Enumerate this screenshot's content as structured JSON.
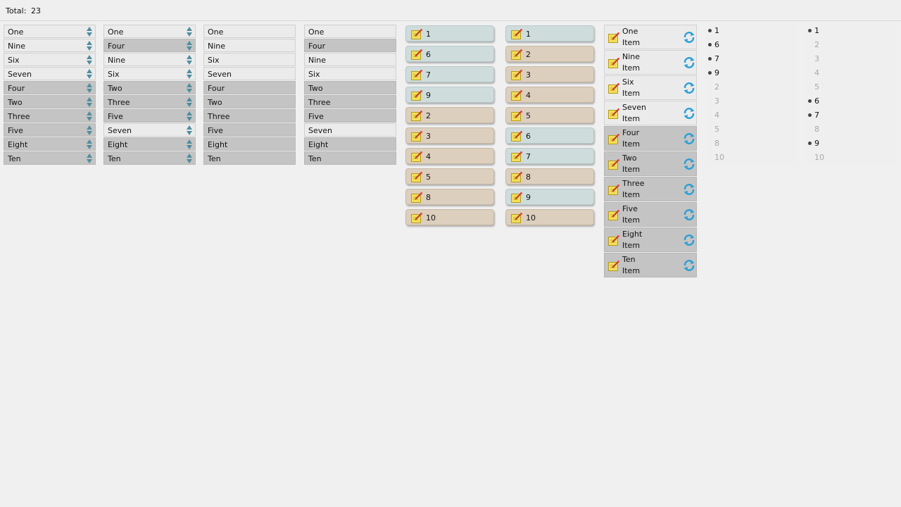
{
  "header": {
    "total_label": "Total:",
    "total_value": "23"
  },
  "spin_list_1": {
    "items": [
      {
        "label": "One",
        "selected": false
      },
      {
        "label": "Nine",
        "selected": false
      },
      {
        "label": "Six",
        "selected": false
      },
      {
        "label": "Seven",
        "selected": false
      },
      {
        "label": "Four",
        "selected": true
      },
      {
        "label": "Two",
        "selected": true
      },
      {
        "label": "Three",
        "selected": true
      },
      {
        "label": "Five",
        "selected": true
      },
      {
        "label": "Eight",
        "selected": true
      },
      {
        "label": "Ten",
        "selected": true
      }
    ]
  },
  "spin_list_2": {
    "items": [
      {
        "label": "One",
        "selected": false
      },
      {
        "label": "Four",
        "selected": true
      },
      {
        "label": "Nine",
        "selected": false
      },
      {
        "label": "Six",
        "selected": false
      },
      {
        "label": "Two",
        "selected": true
      },
      {
        "label": "Three",
        "selected": true
      },
      {
        "label": "Five",
        "selected": true
      },
      {
        "label": "Seven",
        "selected": false
      },
      {
        "label": "Eight",
        "selected": true
      },
      {
        "label": "Ten",
        "selected": true
      }
    ]
  },
  "plain_list_1": {
    "items": [
      {
        "label": "One",
        "selected": false
      },
      {
        "label": "Nine",
        "selected": false
      },
      {
        "label": "Six",
        "selected": false
      },
      {
        "label": "Seven",
        "selected": false
      },
      {
        "label": "Four",
        "selected": true
      },
      {
        "label": "Two",
        "selected": true
      },
      {
        "label": "Three",
        "selected": true
      },
      {
        "label": "Five",
        "selected": true
      },
      {
        "label": "Eight",
        "selected": true
      },
      {
        "label": "Ten",
        "selected": true
      }
    ]
  },
  "plain_list_2": {
    "items": [
      {
        "label": "One",
        "selected": false
      },
      {
        "label": "Four",
        "selected": true
      },
      {
        "label": "Nine",
        "selected": false
      },
      {
        "label": "Six",
        "selected": false
      },
      {
        "label": "Two",
        "selected": true
      },
      {
        "label": "Three",
        "selected": true
      },
      {
        "label": "Five",
        "selected": true
      },
      {
        "label": "Seven",
        "selected": false
      },
      {
        "label": "Eight",
        "selected": true
      },
      {
        "label": "Ten",
        "selected": true
      }
    ]
  },
  "pill_list_1": {
    "items": [
      {
        "label": "1",
        "tone": "blue"
      },
      {
        "label": "6",
        "tone": "blue"
      },
      {
        "label": "7",
        "tone": "blue"
      },
      {
        "label": "9",
        "tone": "blue"
      },
      {
        "label": "2",
        "tone": "tan"
      },
      {
        "label": "3",
        "tone": "tan"
      },
      {
        "label": "4",
        "tone": "tan"
      },
      {
        "label": "5",
        "tone": "tan"
      },
      {
        "label": "8",
        "tone": "tan"
      },
      {
        "label": "10",
        "tone": "tan"
      }
    ]
  },
  "pill_list_2": {
    "items": [
      {
        "label": "1",
        "tone": "blue"
      },
      {
        "label": "2",
        "tone": "tan"
      },
      {
        "label": "3",
        "tone": "tan"
      },
      {
        "label": "4",
        "tone": "tan"
      },
      {
        "label": "5",
        "tone": "tan"
      },
      {
        "label": "6",
        "tone": "blue"
      },
      {
        "label": "7",
        "tone": "blue"
      },
      {
        "label": "8",
        "tone": "tan"
      },
      {
        "label": "9",
        "tone": "blue"
      },
      {
        "label": "10",
        "tone": "tan"
      }
    ]
  },
  "refresh_list": {
    "items": [
      {
        "name": "One",
        "sub": "Item",
        "selected": false
      },
      {
        "name": "Nine",
        "sub": "Item",
        "selected": false
      },
      {
        "name": "Six",
        "sub": "Item",
        "selected": false
      },
      {
        "name": "Seven",
        "sub": "Item",
        "selected": false
      },
      {
        "name": "Four",
        "sub": "Item",
        "selected": true
      },
      {
        "name": "Two",
        "sub": "Item",
        "selected": true
      },
      {
        "name": "Three",
        "sub": "Item",
        "selected": true
      },
      {
        "name": "Five",
        "sub": "Item",
        "selected": true
      },
      {
        "name": "Eight",
        "sub": "Item",
        "selected": true
      },
      {
        "name": "Ten",
        "sub": "Item",
        "selected": true
      }
    ]
  },
  "bullet_list_1": {
    "items": [
      {
        "label": "1",
        "active": true
      },
      {
        "label": "6",
        "active": true
      },
      {
        "label": "7",
        "active": true
      },
      {
        "label": "9",
        "active": true
      },
      {
        "label": "2",
        "active": false
      },
      {
        "label": "3",
        "active": false
      },
      {
        "label": "4",
        "active": false
      },
      {
        "label": "5",
        "active": false
      },
      {
        "label": "8",
        "active": false
      },
      {
        "label": "10",
        "active": false
      }
    ]
  },
  "bullet_list_2": {
    "items": [
      {
        "label": "1",
        "active": true
      },
      {
        "label": "2",
        "active": false
      },
      {
        "label": "3",
        "active": false
      },
      {
        "label": "4",
        "active": false
      },
      {
        "label": "5",
        "active": false
      },
      {
        "label": "6",
        "active": true
      },
      {
        "label": "7",
        "active": true
      },
      {
        "label": "8",
        "active": false
      },
      {
        "label": "9",
        "active": true
      },
      {
        "label": "10",
        "active": false
      }
    ]
  },
  "icons": {
    "note": "note-pencil-icon",
    "refresh": "refresh-icon",
    "spinner": "spinner-arrows-icon"
  },
  "colors": {
    "selected_bg": "#c4c4c4",
    "pill_blue": "#cfdcdc",
    "pill_tan": "#dccfbe",
    "refresh_accent": "#2a9fd6"
  }
}
